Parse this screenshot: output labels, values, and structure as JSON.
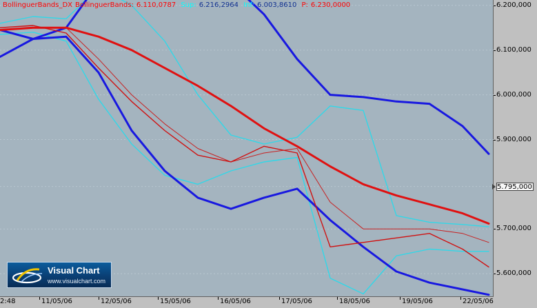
{
  "legend": {
    "indicator": "BollinguerBands_DX",
    "name_prefix": "BollinguerBands:",
    "value": "6.110,0787",
    "sup_label": "Sup:",
    "sup_value": "6.216,2964",
    "inf_label": "Inf:",
    "inf_value": "6.003,8610",
    "price_label": "P:",
    "price_value": "6.230,0000",
    "colors": {
      "indicator": "#ff0000",
      "sup": "#00ffff",
      "inf": "#00ffff",
      "price": "#ff0000"
    }
  },
  "y_axis": {
    "ticks": [
      "6.200,000",
      "6.100,000",
      "6.000,000",
      "5.900,000",
      "5.795,000",
      "5.700,000",
      "5.600,000"
    ],
    "current_price": "5.795,000"
  },
  "x_axis": {
    "ticks": [
      "2:48",
      "11/05/06",
      "12/05/06",
      "15/05/06",
      "16/05/06",
      "17/05/06",
      "18/05/06",
      "19/05/06",
      "22/05/06"
    ]
  },
  "logo": {
    "title": "Visual Chart",
    "url": "www.visualchart.com",
    "icon": "visual-chart-swoosh-logo"
  },
  "chart_data": {
    "type": "line",
    "ylim": [
      5548,
      6212
    ],
    "x": [
      0,
      48,
      96,
      143,
      191,
      239,
      287,
      335,
      383,
      431,
      479,
      527,
      575,
      623,
      671,
      709
    ],
    "series": [
      {
        "role": "price",
        "color": "#d01010",
        "values": [
          6150,
          6155,
          6138,
          6060,
          5985,
          5920,
          5865,
          5850,
          5885,
          5870,
          5660,
          5670,
          5680,
          5690,
          5655,
          5615
        ]
      },
      {
        "role": "moving-average-slow",
        "color": "#e01010",
        "values": [
          6145,
          6150,
          6150,
          6130,
          6100,
          6060,
          6020,
          5975,
          5925,
          5885,
          5840,
          5800,
          5775,
          5755,
          5735,
          5712
        ]
      },
      {
        "role": "moving-average-fast",
        "color": "#c82020",
        "values": [
          6145,
          6150,
          6150,
          6080,
          6000,
          5935,
          5880,
          5850,
          5870,
          5880,
          5760,
          5700,
          5700,
          5700,
          5690,
          5670
        ]
      },
      {
        "role": "upper-band-slow",
        "color": "#1818e0",
        "values": [
          6085,
          6125,
          6150,
          6250,
          6310,
          6300,
          6280,
          6250,
          6180,
          6080,
          6000,
          5995,
          5985,
          5980,
          5930,
          5868
        ]
      },
      {
        "role": "lower-band-slow",
        "color": "#1818e0",
        "values": [
          6145,
          6125,
          6130,
          6050,
          5920,
          5830,
          5770,
          5745,
          5770,
          5790,
          5720,
          5660,
          5605,
          5580,
          5565,
          5553
        ]
      },
      {
        "role": "upper-band-fast",
        "color": "#30d8e8",
        "values": [
          6160,
          6175,
          6170,
          6240,
          6200,
          6120,
          6000,
          5910,
          5890,
          5905,
          5975,
          5965,
          5730,
          5715,
          5710,
          5705
        ]
      },
      {
        "role": "lower-band-fast",
        "color": "#30d8e8",
        "values": [
          6135,
          6140,
          6120,
          5990,
          5890,
          5820,
          5800,
          5830,
          5850,
          5860,
          5590,
          5555,
          5640,
          5655,
          5650,
          5650
        ]
      }
    ]
  }
}
